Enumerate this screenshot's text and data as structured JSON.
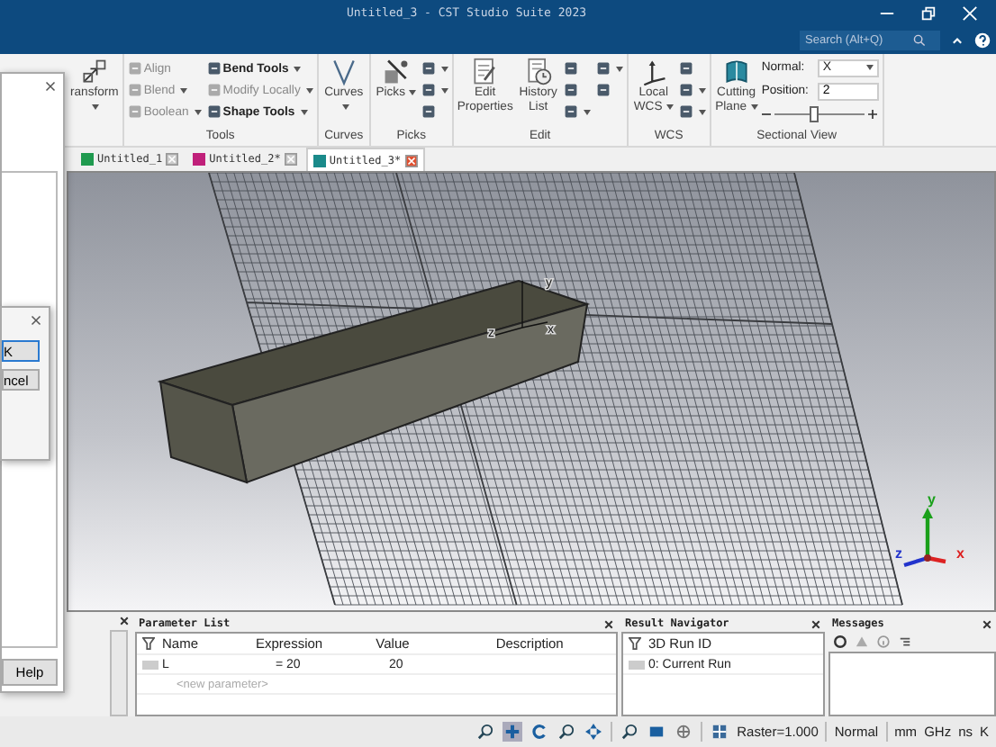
{
  "window": {
    "title": "Untitled_3 - CST Studio Suite 2023"
  },
  "search": {
    "placeholder": "Search (Alt+Q)"
  },
  "ribbon": {
    "groups": [
      {
        "large": [
          {
            "label": "ransform",
            "dropdown": true
          }
        ]
      },
      {
        "label": "Tools",
        "small": [
          {
            "label": "Align",
            "disabled": true,
            "dropdown": false
          },
          {
            "label": "Blend",
            "disabled": true,
            "dropdown": true
          },
          {
            "label": "Boolean",
            "disabled": true,
            "dropdown": true
          },
          {
            "label": "Bend Tools",
            "disabled": false,
            "dropdown": true
          },
          {
            "label": "Modify Locally",
            "disabled": true,
            "dropdown": true
          },
          {
            "label": "Shape Tools",
            "disabled": false,
            "dropdown": true
          }
        ]
      },
      {
        "label": "Curves",
        "large": [
          {
            "label": "Curves",
            "dropdown": true
          }
        ]
      },
      {
        "label": "Picks",
        "large": [
          {
            "label": "Picks",
            "dropdown": true
          }
        ],
        "small": [
          {
            "dropdown": true
          },
          {
            "dropdown": true
          },
          {
            "dropdown": false
          }
        ]
      },
      {
        "label": "Edit",
        "large": [
          {
            "label": "Edit Properties",
            "dropdown": false
          },
          {
            "label": "History List",
            "dropdown": false
          }
        ],
        "small": [
          {
            "dropdown": false
          },
          {
            "dropdown": false
          },
          {
            "dropdown": true
          },
          {
            "dropdown": true
          },
          {
            "dropdown": false
          }
        ]
      },
      {
        "label": "WCS",
        "large": [
          {
            "label": "Local WCS",
            "dropdown": true
          }
        ],
        "small": [
          {
            "dropdown": false
          },
          {
            "dropdown": true
          },
          {
            "dropdown": true
          }
        ]
      },
      {
        "label": "Sectional View",
        "large": [
          {
            "label": "Cutting Plane",
            "dropdown": true
          }
        ],
        "section": {
          "normal_label": "Normal:",
          "normal_value": "X",
          "position_label": "Position:",
          "position_value": "2",
          "level": 0.45
        }
      }
    ]
  },
  "doc_tabs": [
    {
      "label": "Untitled_1",
      "selected": false,
      "color": "#1f9a4f"
    },
    {
      "label": "Untitled_2*",
      "selected": false,
      "color": "#c0207a"
    },
    {
      "label": "Untitled_3*",
      "selected": true,
      "color": "#1a8a8a"
    }
  ],
  "viewport": {
    "local_axes": [
      "y",
      "z",
      "x"
    ],
    "triad": [
      {
        "label": "y",
        "color": "#1aa01a"
      },
      {
        "label": "z",
        "color": "#2233cc"
      },
      {
        "label": "x",
        "color": "#dd2222"
      }
    ]
  },
  "side_dialog": {
    "button": "Help"
  },
  "small_dialog": {
    "buttons": [
      {
        "label": "K",
        "default": true
      },
      {
        "label": "ncel",
        "default": false
      }
    ]
  },
  "parameter_list": {
    "title": "Parameter List",
    "columns": [
      "Name",
      "Expression",
      "Value",
      "Description"
    ],
    "rows": [
      [
        "L",
        "= 20",
        "20"
      ]
    ],
    "new_row": "<new parameter>"
  },
  "result_navigator": {
    "title": "Result Navigator",
    "column": "3D Run ID",
    "rows": [
      "0: Current Run"
    ]
  },
  "messages": {
    "title": "Messages"
  },
  "status_bar": {
    "raster": "Raster=1.000",
    "mode": "Normal",
    "units": [
      "mm",
      "GHz",
      "ns",
      "K"
    ]
  }
}
